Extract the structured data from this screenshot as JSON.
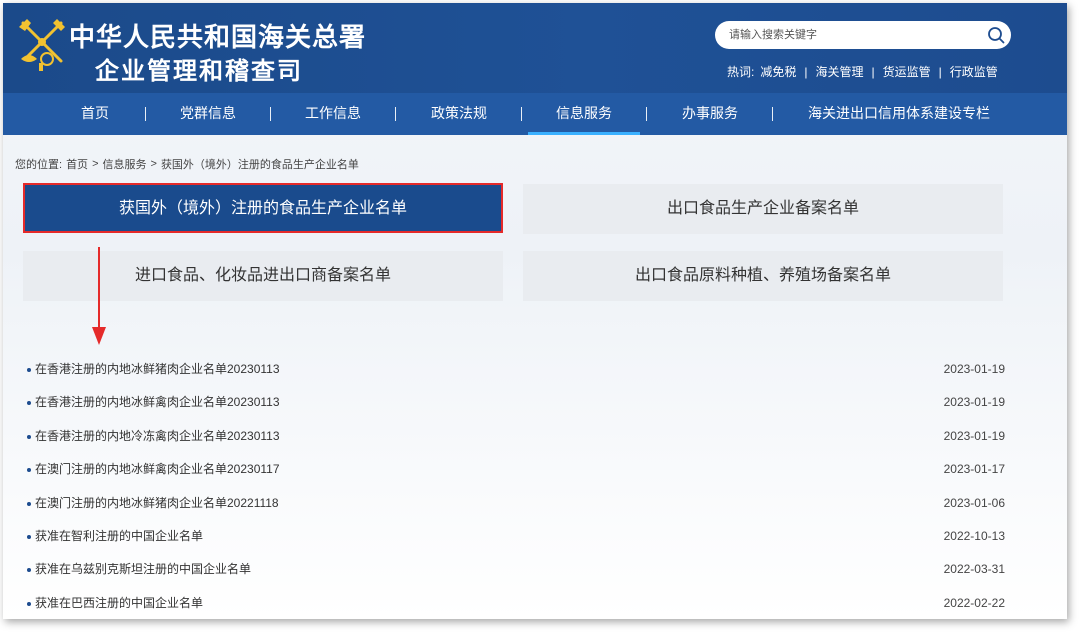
{
  "header": {
    "title_line1": "中华人民共和国海关总署",
    "title_line2": "企业管理和稽查司",
    "search_placeholder": "请输入搜索关键字",
    "hotwords_label": "热词:",
    "hotwords": [
      "减免税",
      "海关管理",
      "货运监管",
      "行政监管"
    ]
  },
  "nav": {
    "items": [
      {
        "label": "首页"
      },
      {
        "label": "党群信息"
      },
      {
        "label": "工作信息"
      },
      {
        "label": "政策法规"
      },
      {
        "label": "信息服务"
      },
      {
        "label": "办事服务"
      },
      {
        "label": "海关进出口信用体系建设专栏"
      }
    ],
    "active_index": 4
  },
  "breadcrumb": {
    "prefix": "您的位置:",
    "items": [
      "首页",
      "信息服务",
      "获国外（境外）注册的食品生产企业名单"
    ],
    "separator": ">"
  },
  "categories": [
    {
      "label": "获国外（境外）注册的食品生产企业名单",
      "active": true
    },
    {
      "label": "出口食品生产企业备案名单",
      "active": false
    },
    {
      "label": "进口食品、化妆品进出口商备案名单",
      "active": false
    },
    {
      "label": "出口食品原料种植、养殖场备案名单",
      "active": false
    }
  ],
  "news": [
    {
      "title": "在香港注册的内地冰鲜猪肉企业名单20230113",
      "date": "2023-01-19"
    },
    {
      "title": "在香港注册的内地冰鲜禽肉企业名单20230113",
      "date": "2023-01-19"
    },
    {
      "title": "在香港注册的内地冷冻禽肉企业名单20230113",
      "date": "2023-01-19"
    },
    {
      "title": "在澳门注册的内地冰鲜禽肉企业名单20230117",
      "date": "2023-01-17"
    },
    {
      "title": "在澳门注册的内地冰鲜猪肉企业名单20221118",
      "date": "2023-01-06"
    },
    {
      "title": "获准在智利注册的中国企业名单",
      "date": "2022-10-13"
    },
    {
      "title": "获准在乌兹别克斯坦注册的中国企业名单",
      "date": "2022-03-31"
    },
    {
      "title": "获准在巴西注册的中国企业名单",
      "date": "2022-02-22"
    }
  ],
  "colors": {
    "header_bg": "#1d4c8f",
    "nav_bg": "#235aa4",
    "active_tile_bg": "#1a4b8d",
    "highlight_border": "#e52a2a",
    "tile_bg": "#e9ecf0"
  }
}
